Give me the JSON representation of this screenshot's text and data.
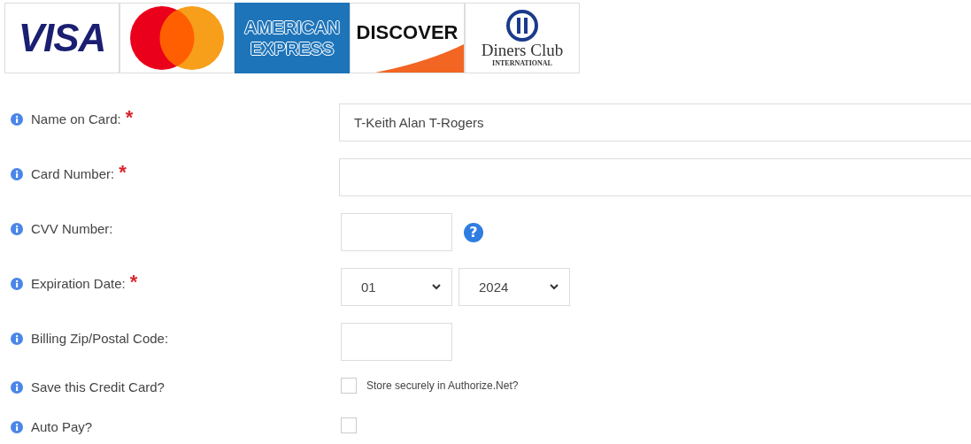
{
  "card_logos": [
    {
      "kind": "visa",
      "lines": [
        "VISA"
      ]
    },
    {
      "kind": "mastercard"
    },
    {
      "kind": "amex",
      "lines": [
        "AMERICAN",
        "EXPRESS"
      ]
    },
    {
      "kind": "discover",
      "lines": [
        "DISCOVER"
      ]
    },
    {
      "kind": "diners",
      "lines": [
        "Diners Club",
        "INTERNATIONAL"
      ]
    }
  ],
  "fields": [
    {
      "label": "Name on Card:",
      "required_mark": "*",
      "kind": "wide",
      "value": "T-Keith Alan T-Rogers"
    },
    {
      "label": "Card Number:",
      "required_mark": "*",
      "kind": "wide"
    },
    {
      "label": "CVV Number:",
      "kind": "short",
      "help": "?"
    },
    {
      "label": "Expiration Date:",
      "required_mark": "*",
      "kind": "selects",
      "selects": [
        "01",
        "2024"
      ]
    },
    {
      "label": "Billing Zip/Postal Code:",
      "kind": "short"
    },
    {
      "label": "Save this Credit Card?",
      "kind": "checkbox",
      "checked": false,
      "text": "Store securely in Authorize.Net?"
    },
    {
      "label": "Auto Pay?",
      "kind": "checkbox",
      "checked": false
    }
  ]
}
